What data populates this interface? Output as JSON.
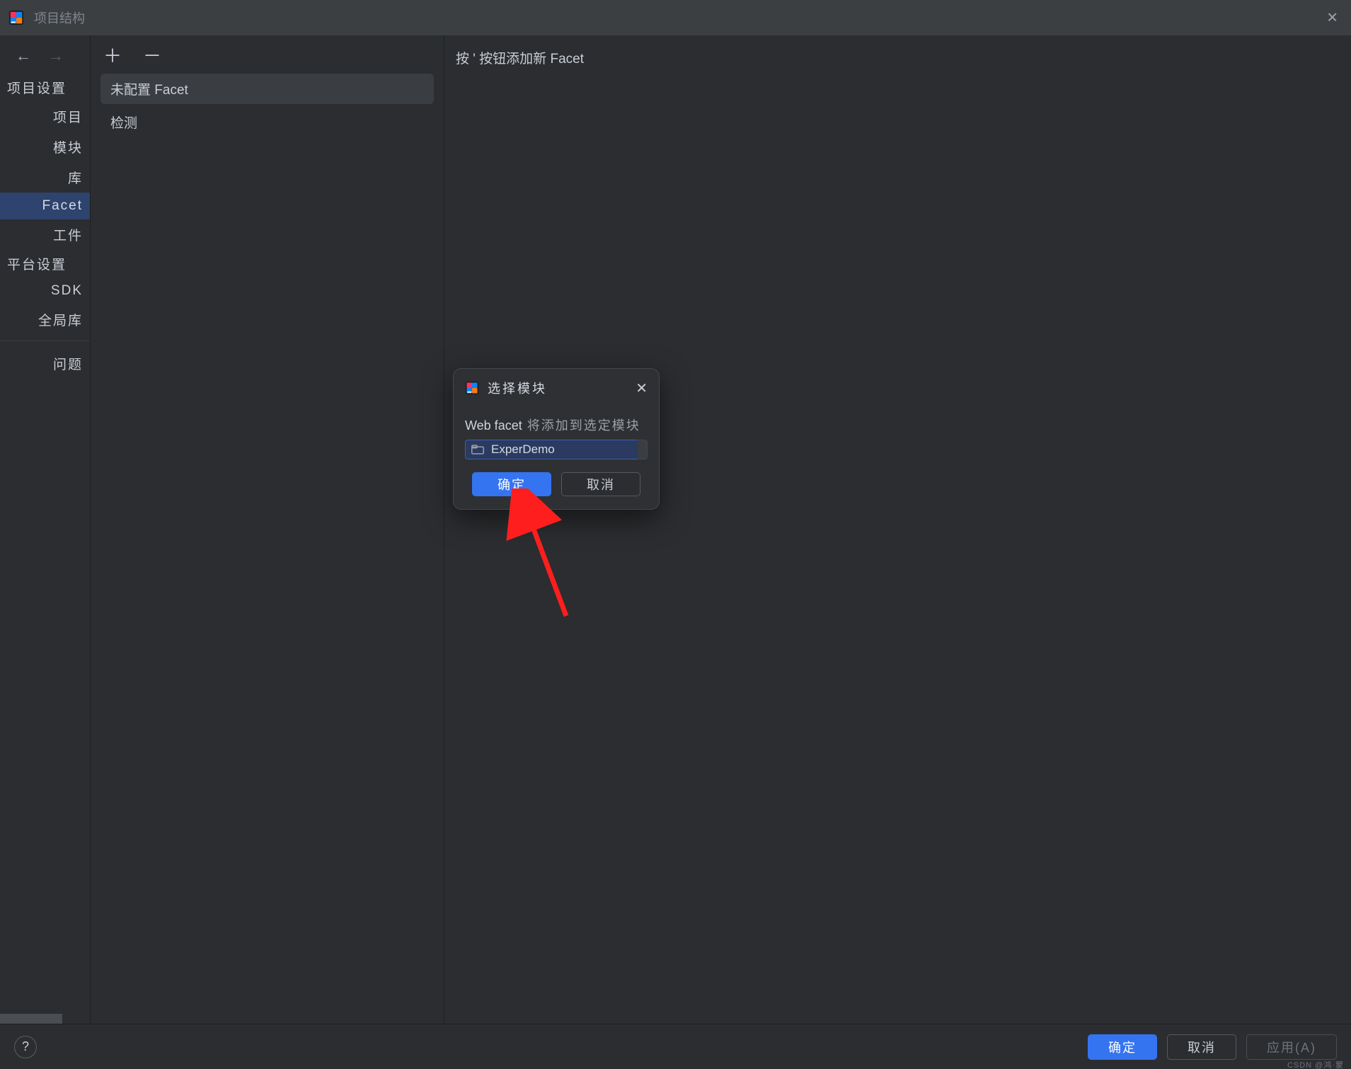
{
  "window": {
    "title": "项目结构",
    "close_glyph": "✕"
  },
  "sidebar": {
    "nav_back_glyph": "←",
    "nav_forward_glyph": "→",
    "groups": [
      {
        "title": "项目设置",
        "items": [
          {
            "label": "项目",
            "selected": false
          },
          {
            "label": "模块",
            "selected": false
          },
          {
            "label": "库",
            "selected": false
          },
          {
            "label": "Facet",
            "selected": true
          },
          {
            "label": "工件",
            "selected": false
          }
        ]
      },
      {
        "title": "平台设置",
        "items": [
          {
            "label": "SDK",
            "selected": false
          },
          {
            "label": "全局库",
            "selected": false
          }
        ]
      }
    ],
    "extra_item": "问题"
  },
  "middle": {
    "add_glyph": "＋",
    "remove_glyph": "－",
    "items": [
      {
        "label": "未配置 Facet",
        "selected": true
      },
      {
        "label": "检测",
        "selected": false
      }
    ]
  },
  "content": {
    "hint": "按 ' 按钮添加新 Facet"
  },
  "dialog": {
    "title": "选择模块",
    "close_glyph": "✕",
    "desc_strong": "Web facet",
    "desc_rest": " 将添加到选定模块",
    "selected_module": "ExperDemo",
    "ok_label": "确定",
    "cancel_label": "取消"
  },
  "footer": {
    "help_glyph": "?",
    "ok_label": "确定",
    "cancel_label": "取消",
    "apply_label": "应用(A)",
    "watermark": "CSDN @鸿·蒙"
  }
}
